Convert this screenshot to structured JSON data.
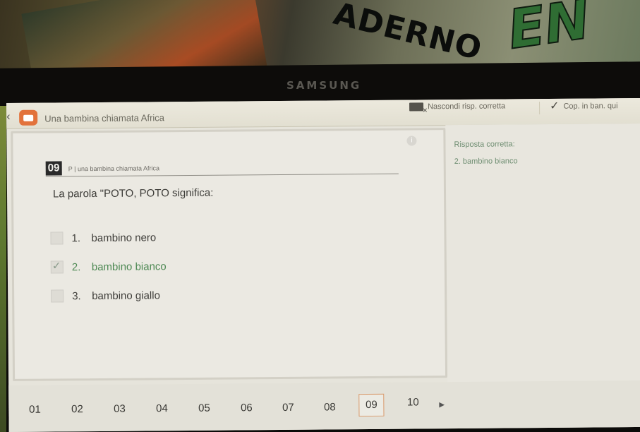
{
  "device": {
    "brand": "SAMSUNG",
    "cover_text": "ADERNO",
    "cover_text_2": "EN"
  },
  "topbar": {
    "back_icon": "chevron-left-icon",
    "app_icon": "app-logo-icon",
    "doc_title": "Una bambina chiamata Africa",
    "hide_answer_label": "Nascondi risp. corretta",
    "copy_label": "Cop. in ban. qui"
  },
  "question": {
    "number": "09",
    "source": "P | una bambina chiamata Africa",
    "text": "La parola \"POTO, POTO significa:",
    "options": [
      {
        "num": "1.",
        "label": "bambino nero",
        "checked": false
      },
      {
        "num": "2.",
        "label": "bambino bianco",
        "checked": true
      },
      {
        "num": "3.",
        "label": "bambino giallo",
        "checked": false
      }
    ]
  },
  "answer": {
    "label": "Risposta corretta:",
    "value": "2. bambino bianco"
  },
  "pager": {
    "pages": [
      "01",
      "02",
      "03",
      "04",
      "05",
      "06",
      "07",
      "08",
      "09",
      "10"
    ],
    "active": "09",
    "next_icon": "triangle-right-icon"
  },
  "colors": {
    "accent": "#e2723b",
    "correct": "#4f8a55",
    "active_border": "#d89a6c"
  }
}
